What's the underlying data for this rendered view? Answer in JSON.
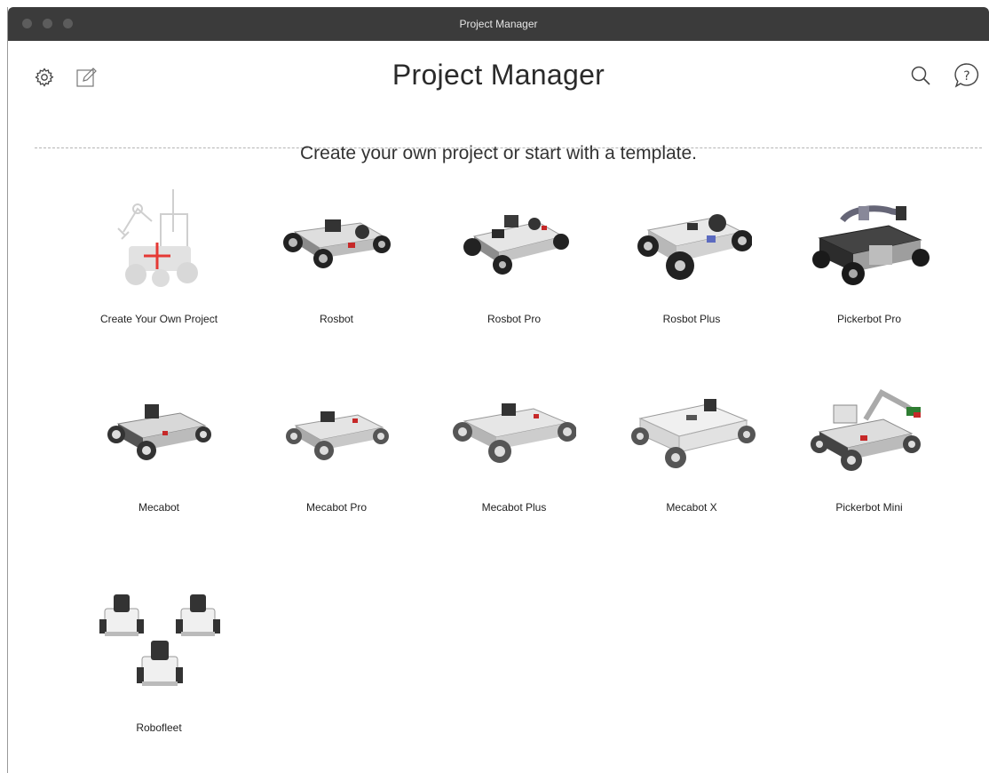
{
  "window": {
    "title": "Project Manager"
  },
  "header": {
    "title": "Project Manager",
    "settings_icon": "gear-icon",
    "edit_icon": "edit-icon",
    "search_icon": "search-icon",
    "help_icon": "help-icon"
  },
  "main": {
    "subtitle": "Create your own project or start with a template.",
    "templates": [
      {
        "label": "Create Your Own Project",
        "icon": "create-project-icon"
      },
      {
        "label": "Rosbot",
        "icon": "robot-image"
      },
      {
        "label": "Rosbot Pro",
        "icon": "robot-image"
      },
      {
        "label": "Rosbot Plus",
        "icon": "robot-image"
      },
      {
        "label": "Pickerbot Pro",
        "icon": "robot-image"
      },
      {
        "label": "Mecabot",
        "icon": "robot-image"
      },
      {
        "label": "Mecabot Pro",
        "icon": "robot-image"
      },
      {
        "label": "Mecabot Plus",
        "icon": "robot-image"
      },
      {
        "label": "Mecabot X",
        "icon": "robot-image"
      },
      {
        "label": "Pickerbot Mini",
        "icon": "robot-image"
      },
      {
        "label": "Robofleet",
        "icon": "robot-fleet-image"
      }
    ]
  },
  "colors": {
    "titlebar": "#3b3b3b",
    "accent_red": "#e53935"
  }
}
